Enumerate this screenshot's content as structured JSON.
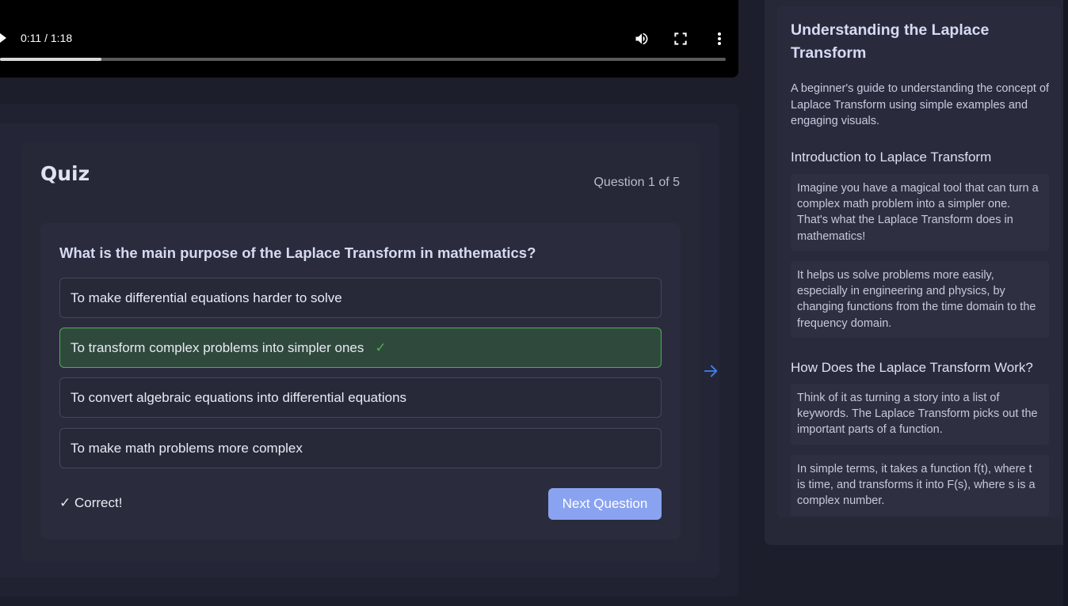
{
  "video": {
    "time": "0:11 / 1:18",
    "progress_fraction": 0.14,
    "icons": [
      "play-icon",
      "volume-icon",
      "fullscreen-icon",
      "more-options-icon"
    ]
  },
  "quiz": {
    "title": "Quiz",
    "counter": "Question 1 of 5",
    "question": "What is the main purpose of the Laplace Transform in mathematics?",
    "options": [
      {
        "label": "To make differential equations harder to solve",
        "state": "default"
      },
      {
        "label": "To transform complex problems into simpler ones",
        "state": "correct"
      },
      {
        "label": "To convert algebraic equations into differential equations",
        "state": "default"
      },
      {
        "label": "To make math problems more complex",
        "state": "default"
      }
    ],
    "check_mark": "✓",
    "result": "✓ Correct!",
    "next_label": "Next Question"
  },
  "sidebar": {
    "title": "Understanding the Laplace Transform",
    "description": "A beginner's guide to understanding the concept of Laplace Transform using simple examples and engaging visuals.",
    "sections": [
      {
        "heading": "Introduction to Laplace Transform",
        "paragraphs": [
          "Imagine you have a magical tool that can turn a complex math problem into a simpler one. That's what the Laplace Transform does in mathematics!",
          "It helps us solve problems more easily, especially in engineering and physics, by changing functions from the time domain to the frequency domain."
        ]
      },
      {
        "heading": "How Does the Laplace Transform Work?",
        "paragraphs": [
          "Think of it as turning a story into a list of keywords. The Laplace Transform picks out the important parts of a function.",
          "In simple terms, it takes a function f(t), where t is time, and transforms it into F(s), where s is a complex number."
        ]
      }
    ]
  },
  "colors": {
    "accent": "#8aa3f0",
    "correct": "#4caf50",
    "arrow": "#3b82f6"
  }
}
